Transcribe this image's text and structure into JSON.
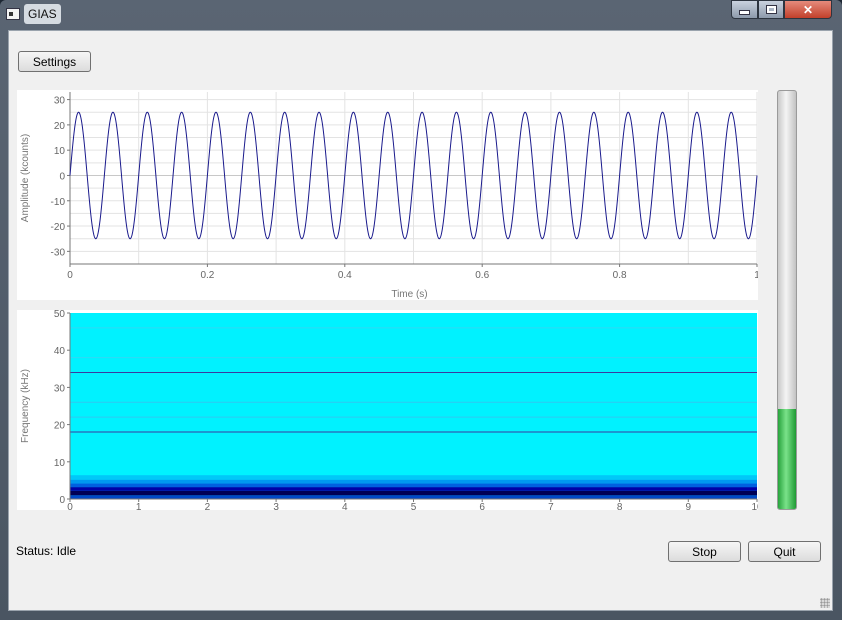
{
  "window": {
    "title": "GIAS",
    "close_glyph": "✕"
  },
  "toolbar": {
    "settings_label": "Settings"
  },
  "status": {
    "label": "Status: Idle"
  },
  "controls": {
    "stop_label": "Stop",
    "quit_label": "Quit"
  },
  "level_meter": {
    "value": 0.24,
    "color": "#2fb84a"
  },
  "chart_data": [
    {
      "type": "line",
      "xlabel": "Time (s)",
      "ylabel": "Amplitude (kcounts)",
      "xlim": [
        0,
        1
      ],
      "ylim": [
        -35,
        33
      ],
      "xticks": [
        "0",
        "0.2",
        "0.4",
        "0.6",
        "0.8",
        "1"
      ],
      "yticks": [
        "30",
        "20",
        "10",
        "0",
        "-10",
        "-20",
        "-30"
      ],
      "grid": true,
      "series": [
        {
          "function": "sine",
          "amplitude": 25,
          "frequency_hz": 20,
          "color": "#1a1a8c"
        }
      ]
    },
    {
      "type": "heatmap",
      "xlabel": "",
      "ylabel": "Frequency (kHz)",
      "xlim": [
        0,
        10
      ],
      "ylim": [
        0,
        50
      ],
      "xticks": [
        "0",
        "1",
        "2",
        "3",
        "4",
        "5",
        "6",
        "7",
        "8",
        "9",
        "10"
      ],
      "yticks": [
        "50",
        "40",
        "30",
        "20",
        "10",
        "0"
      ],
      "background_color": "#00f2ff",
      "bands": [
        {
          "from": 0.0,
          "to": 1.0,
          "color": "#0048c8"
        },
        {
          "from": 1.0,
          "to": 2.2,
          "color": "#000055"
        },
        {
          "from": 2.2,
          "to": 3.2,
          "color": "#0000a8"
        },
        {
          "from": 3.2,
          "to": 4.2,
          "color": "#0060e0"
        },
        {
          "from": 4.2,
          "to": 5.2,
          "color": "#0098f0"
        },
        {
          "from": 5.2,
          "to": 6.4,
          "color": "#00c8f8"
        }
      ],
      "lines": [
        {
          "freq": 18,
          "color": "#3a3aa0"
        },
        {
          "freq": 22,
          "color": "#30c8f0"
        },
        {
          "freq": 26,
          "color": "#30c8f0"
        },
        {
          "freq": 34,
          "color": "#3a3aa0"
        },
        {
          "freq": 38,
          "color": "#30d8f4"
        },
        {
          "freq": 46,
          "color": "#30d8f4"
        }
      ]
    }
  ]
}
